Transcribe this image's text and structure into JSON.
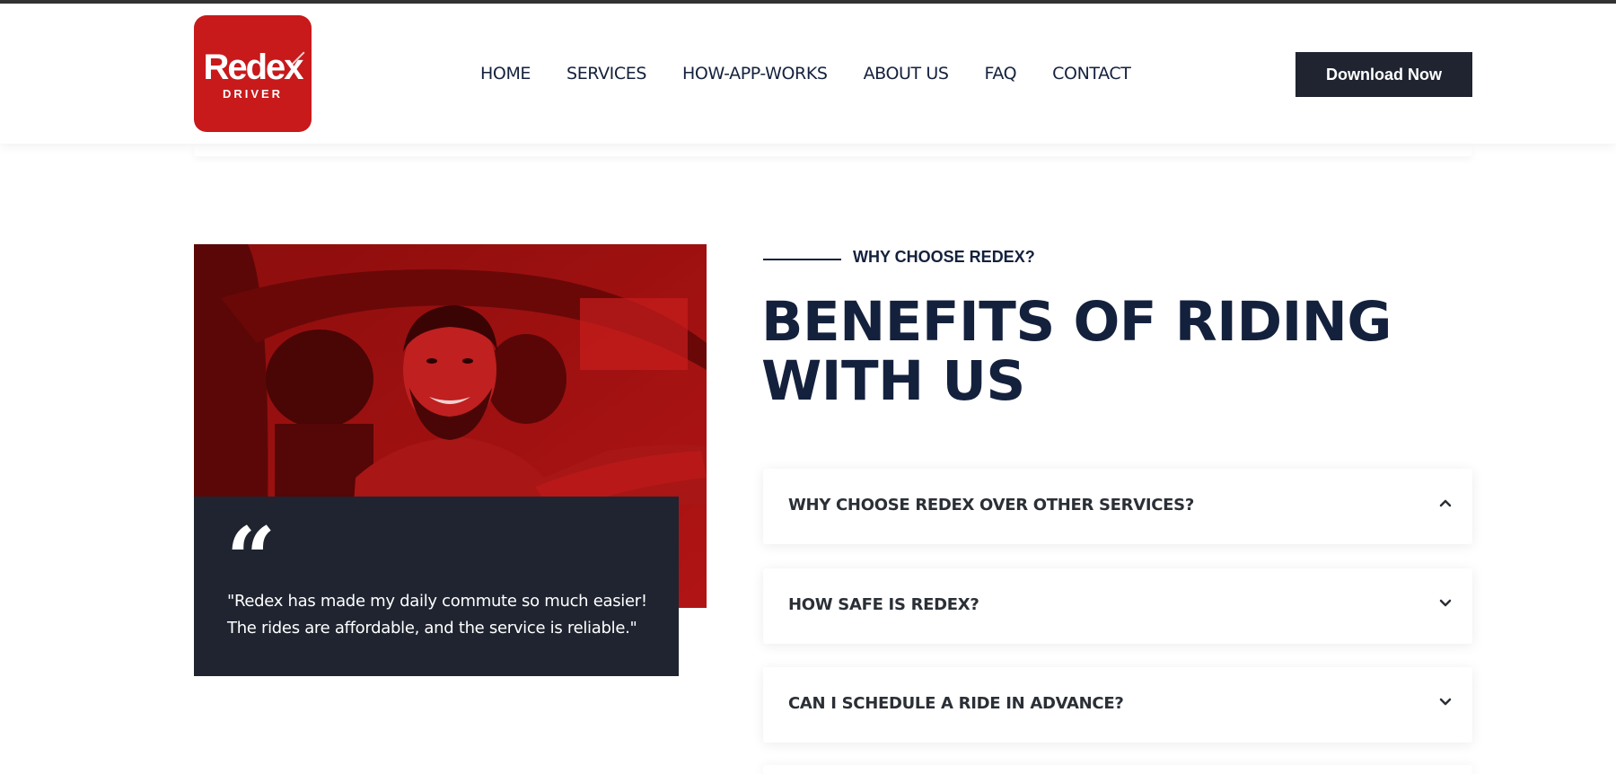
{
  "brand": {
    "name": "Redex",
    "sub": "DRIVER",
    "color": "#c8191b"
  },
  "nav": {
    "items": [
      "HOME",
      "SERVICES",
      "HOW-APP-WORKS",
      "ABOUT US",
      "FAQ",
      "CONTACT"
    ],
    "cta_label": "Download Now"
  },
  "testimonial": {
    "quote_mark": "“",
    "text": "\"Redex has made my daily commute so much easier! The rides are affordable, and the service is reliable.\""
  },
  "section": {
    "eyebrow": "WHY CHOOSE REDEX?",
    "title": "BENEFITS OF RIDING WITH US"
  },
  "faq": [
    {
      "question": "WHY CHOOSE REDEX OVER OTHER SERVICES?",
      "icon": "chevron-up-icon",
      "expanded": true
    },
    {
      "question": "HOW SAFE IS REDEX?",
      "icon": "chevron-down-icon",
      "expanded": false
    },
    {
      "question": "CAN I SCHEDULE A RIDE IN ADVANCE?",
      "icon": "chevron-down-icon",
      "expanded": false
    }
  ],
  "colors": {
    "navy": "#14213d",
    "dark": "#1f2430",
    "red": "#c8191b"
  }
}
